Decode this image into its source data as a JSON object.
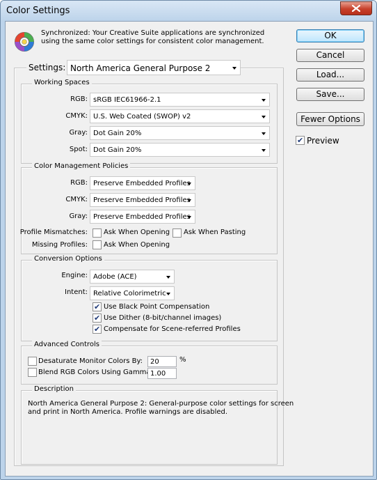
{
  "window": {
    "title": "Color Settings"
  },
  "sync": {
    "message_line1": "Synchronized: Your Creative Suite applications are synchronized",
    "message_line2": "using the same color settings for consistent color management."
  },
  "settings": {
    "label": "Settings:",
    "value": "North America General Purpose 2"
  },
  "working_spaces": {
    "title": "Working Spaces",
    "rgb_label": "RGB:",
    "rgb_value": "sRGB IEC61966-2.1",
    "cmyk_label": "CMYK:",
    "cmyk_value": "U.S. Web Coated (SWOP) v2",
    "gray_label": "Gray:",
    "gray_value": "Dot Gain 20%",
    "spot_label": "Spot:",
    "spot_value": "Dot Gain 20%"
  },
  "policies": {
    "title": "Color Management Policies",
    "rgb_label": "RGB:",
    "rgb_value": "Preserve Embedded Profiles",
    "cmyk_label": "CMYK:",
    "cmyk_value": "Preserve Embedded Profiles",
    "gray_label": "Gray:",
    "gray_value": "Preserve Embedded Profiles",
    "mismatch_label": "Profile Mismatches:",
    "ask_opening": {
      "label": "Ask When Opening",
      "checked": false
    },
    "ask_pasting": {
      "label": "Ask When Pasting",
      "checked": false
    },
    "missing_label": "Missing Profiles:",
    "missing_ask_opening": {
      "label": "Ask When Opening",
      "checked": false
    }
  },
  "conversion": {
    "title": "Conversion Options",
    "engine_label": "Engine:",
    "engine_value": "Adobe (ACE)",
    "intent_label": "Intent:",
    "intent_value": "Relative Colorimetric",
    "black_point": {
      "label": "Use Black Point Compensation",
      "checked": true
    },
    "dither": {
      "label": "Use Dither (8-bit/channel images)",
      "checked": true
    },
    "scene_referred": {
      "label": "Compensate for Scene-referred Profiles",
      "checked": true
    }
  },
  "advanced": {
    "title": "Advanced Controls",
    "desaturate": {
      "label": "Desaturate Monitor Colors By:",
      "checked": false,
      "value": "20",
      "unit": "%"
    },
    "blend": {
      "label": "Blend RGB Colors Using Gamma:",
      "checked": false,
      "value": "1.00"
    }
  },
  "description": {
    "title": "Description",
    "line1": "North America General Purpose 2:  General-purpose color settings for screen",
    "line2": "and print in North America. Profile warnings are disabled."
  },
  "buttons": {
    "ok": "OK",
    "cancel": "Cancel",
    "load": "Load...",
    "save": "Save...",
    "fewer_options": "Fewer Options"
  },
  "preview": {
    "label": "Preview",
    "checked": true
  },
  "check_mark": "✔",
  "colors": {
    "title_bar": "#bcd3ea",
    "dialog_bg": "#f0f0f0",
    "close_button": "#c7402a",
    "default_button_border": "#3c7fb1"
  }
}
